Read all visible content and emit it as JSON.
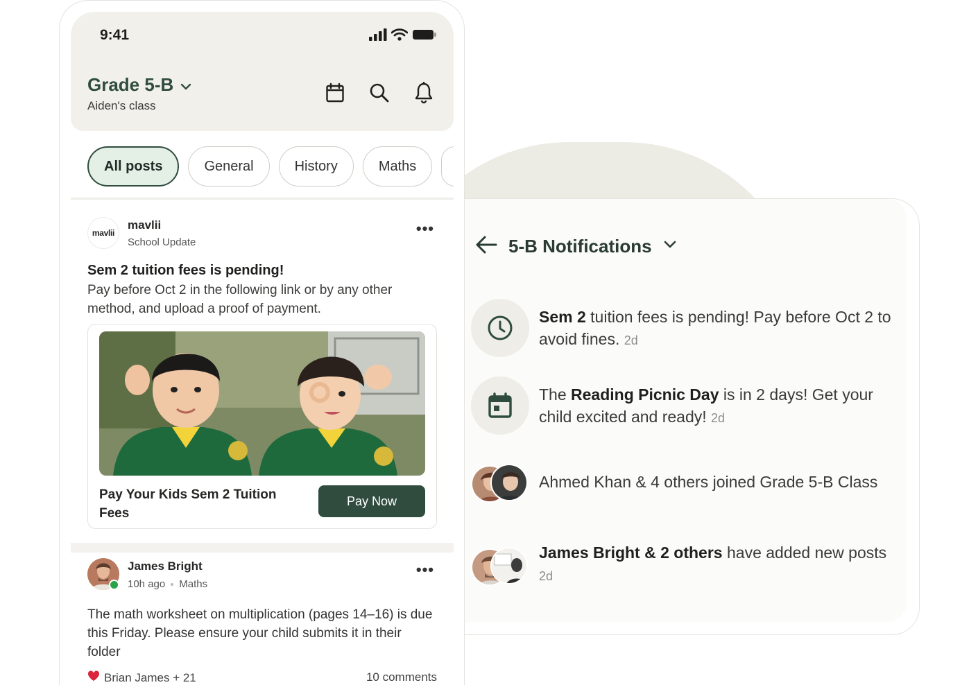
{
  "status": {
    "time": "9:41"
  },
  "header": {
    "class_name": "Grade 5-B",
    "class_sub": "Aiden's class"
  },
  "tabs": [
    {
      "label": "All posts",
      "active": true
    },
    {
      "label": "General",
      "active": false
    },
    {
      "label": "History",
      "active": false
    },
    {
      "label": "Maths",
      "active": false
    }
  ],
  "post1": {
    "logo_text": "mavlii",
    "author": "mavlii",
    "subtitle": "School Update",
    "title": "Sem 2 tuition fees is pending!",
    "body": "Pay before Oct 2 in the following link or by any other method, and upload a proof of payment.",
    "card_title": "Pay Your Kids Sem 2 Tuition Fees",
    "card_button": "Pay Now"
  },
  "post2": {
    "author": "James Bright",
    "time": "10h ago",
    "subject": "Maths",
    "body": "The math worksheet on multiplication (pages 14–16) is due this Friday. Please ensure your child submits it in their folder",
    "likes": "Brian James  + 21",
    "comments": "10 comments"
  },
  "notifications": {
    "title": "5-B Notifications",
    "items": [
      {
        "bold": "Sem 2",
        "text": " tuition fees is pending! Pay before Oct 2 to avoid fines.",
        "time": "2d"
      },
      {
        "pre": "The ",
        "bold": "Reading Picnic Day",
        "text": " is in 2 days! Get your child excited and ready!",
        "time": "2d"
      },
      {
        "text": "Ahmed Khan & 4 others joined Grade 5-B Class"
      },
      {
        "bold": "James Bright & 2 others",
        "text": " have added new posts",
        "time": "2d"
      }
    ]
  },
  "colors": {
    "brand": "#2f4c3e",
    "tab_active_bg": "#e4efe6",
    "topbar_bg": "#f1f0eb",
    "online": "#27a348",
    "heart": "#d9263c"
  }
}
